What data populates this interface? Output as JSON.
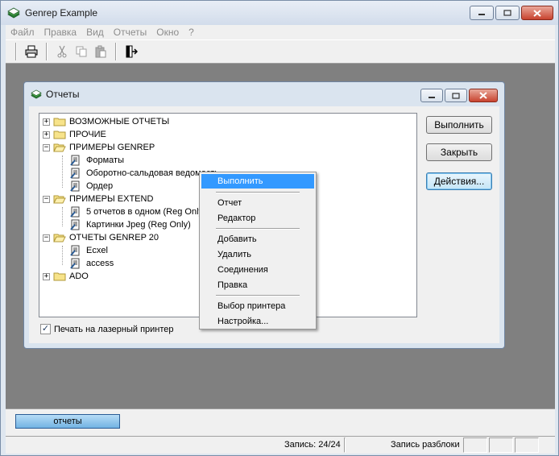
{
  "app": {
    "title": "Genrep Example",
    "menu": [
      "Файл",
      "Правка",
      "Вид",
      "Отчеты",
      "Окно",
      "?"
    ]
  },
  "child": {
    "title": "Отчеты"
  },
  "tree": {
    "nodes": [
      {
        "label": "ВОЗМОЖНЫЕ ОТЧЕТЫ",
        "kind": "folder",
        "expander": "+"
      },
      {
        "label": "ПРОЧИЕ",
        "kind": "folder",
        "expander": "+"
      },
      {
        "label": "ПРИМЕРЫ GENREP",
        "kind": "folder-open",
        "expander": "−"
      },
      {
        "label": "Форматы",
        "kind": "report"
      },
      {
        "label": "Оборотно-сальдовая ведомость",
        "kind": "report"
      },
      {
        "label": "Ордер",
        "kind": "report"
      },
      {
        "label": "ПРИМЕРЫ EXTEND",
        "kind": "folder-open",
        "expander": "−"
      },
      {
        "label": "5 отчетов в одном (Reg Only)",
        "kind": "report"
      },
      {
        "label": "Картинки Jpeg  (Reg Only)",
        "kind": "report"
      },
      {
        "label": "ОТЧЕТЫ GENREP 20",
        "kind": "folder-open",
        "expander": "−"
      },
      {
        "label": "Ecxel",
        "kind": "report"
      },
      {
        "label": "access",
        "kind": "report"
      },
      {
        "label": "ADO",
        "kind": "folder",
        "expander": "+"
      }
    ]
  },
  "buttons": {
    "run": "Выполнить",
    "close": "Закрыть",
    "actions": "Действия..."
  },
  "laser_printer": {
    "label": "Печать на лазерный принтер",
    "checked": true
  },
  "context_menu": {
    "items": {
      "run": "Выполнить",
      "report": "Отчет",
      "editor": "Редактор",
      "add": "Добавить",
      "delete": "Удалить",
      "connections": "Соединения",
      "edit": "Правка",
      "printer": "Выбор принтера",
      "settings": "Настройка..."
    }
  },
  "taskbar": {
    "window_button": "отчеты"
  },
  "status": {
    "record": "Запись: 24/24",
    "record_split": "Запись разблоки"
  },
  "colors": {
    "highlight": "#3399ff",
    "mdi_background": "#808080"
  }
}
